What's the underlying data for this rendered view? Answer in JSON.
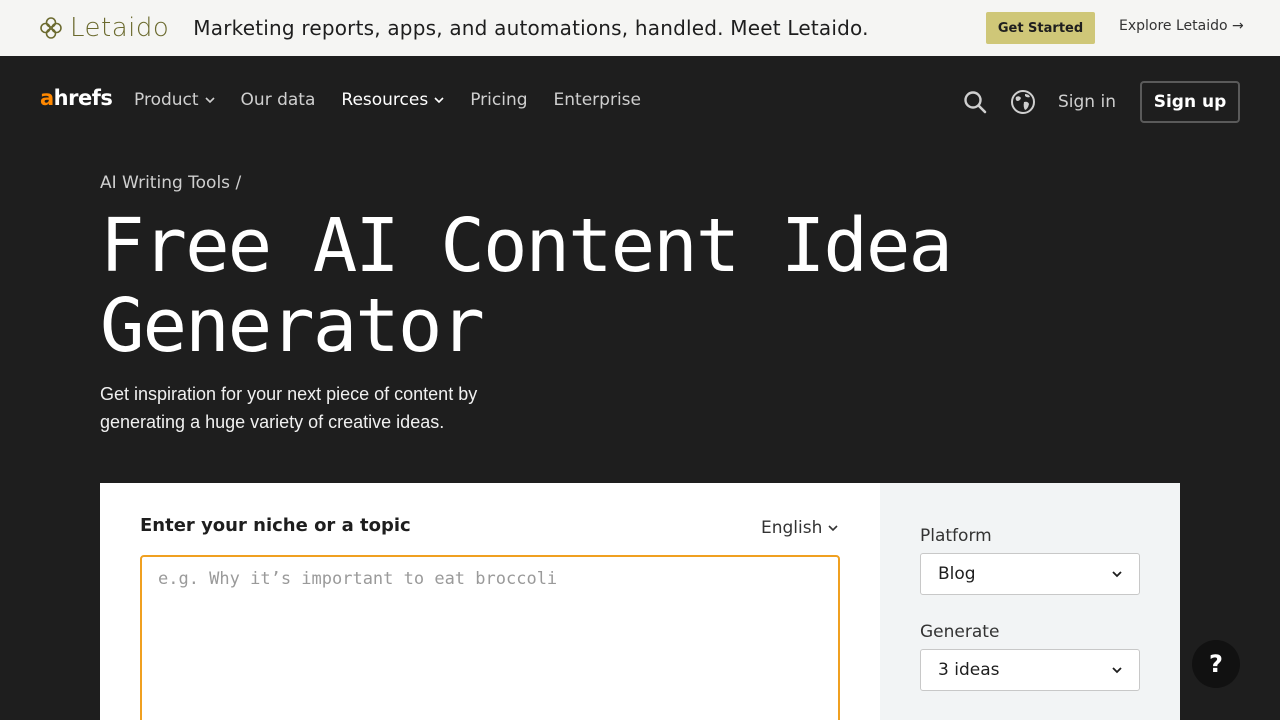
{
  "promo": {
    "brand_name": "Letaido",
    "tagline": "Marketing reports, apps, and automations, handled. Meet Letaido.",
    "cta_label": "Get Started",
    "explore_label": "Explore Letaido →"
  },
  "nav": {
    "logo_a": "a",
    "logo_rest": "hrefs",
    "items": [
      {
        "label": "Product",
        "has_chevron": true
      },
      {
        "label": "Our data",
        "has_chevron": false
      },
      {
        "label": "Resources",
        "has_chevron": true
      },
      {
        "label": "Pricing",
        "has_chevron": false
      },
      {
        "label": "Enterprise",
        "has_chevron": false
      }
    ],
    "signin_label": "Sign in",
    "signup_label": "Sign up"
  },
  "hero": {
    "breadcrumb": "AI Writing Tools /",
    "title": "Free AI Content Idea Generator",
    "subtitle": "Get inspiration for your next piece of content by generating a huge variety of creative ideas."
  },
  "tool": {
    "input_label": "Enter your niche or a topic",
    "language": "English",
    "placeholder": "e.g. Why it’s important to eat broccoli",
    "platform_label": "Platform",
    "platform_value": "Blog",
    "generate_label": "Generate",
    "generate_value": "3 ideas"
  },
  "help_label": "?",
  "colors": {
    "background": "#1e1e1e",
    "accent_orange": "#ff8800",
    "promo_bg": "#f5f5f3",
    "promo_cta": "#cfc778",
    "input_focus": "#f0a020"
  }
}
